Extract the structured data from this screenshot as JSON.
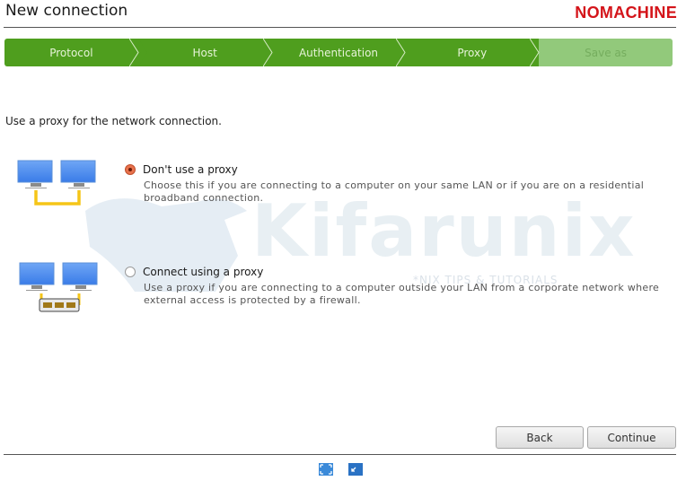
{
  "window": {
    "title": "New connection",
    "brand": "NOMACHINE"
  },
  "colors": {
    "brand_red": "#d4141a",
    "step_active": "#4f9e1e",
    "step_inactive": "#92c97b",
    "radio_checked": "#e9734d"
  },
  "steps": [
    {
      "label": "Protocol",
      "state": "done"
    },
    {
      "label": "Host",
      "state": "done"
    },
    {
      "label": "Authentication",
      "state": "done"
    },
    {
      "label": "Proxy",
      "state": "current"
    },
    {
      "label": "Save as",
      "state": "inactive"
    }
  ],
  "main": {
    "intro": "Use a proxy for the network connection.",
    "options": [
      {
        "label": "Don't use a proxy",
        "description": "Choose this if you are connecting to a computer on your same LAN or if you are on a residential broadband connection.",
        "checked": true,
        "icon": "direct-network-icon"
      },
      {
        "label": "Connect using a proxy",
        "description": "Use a proxy if you are connecting to a computer outside your LAN from a corporate network where external access is protected by a firewall.",
        "checked": false,
        "icon": "proxy-network-icon"
      }
    ]
  },
  "watermark": {
    "text": "Kifarunix",
    "subtext": "*NIX TIPS & TUTORIALS"
  },
  "buttons": {
    "back": "Back",
    "continue": "Continue"
  },
  "bottom_icons": [
    "fullscreen-icon",
    "minimize-window-icon"
  ]
}
